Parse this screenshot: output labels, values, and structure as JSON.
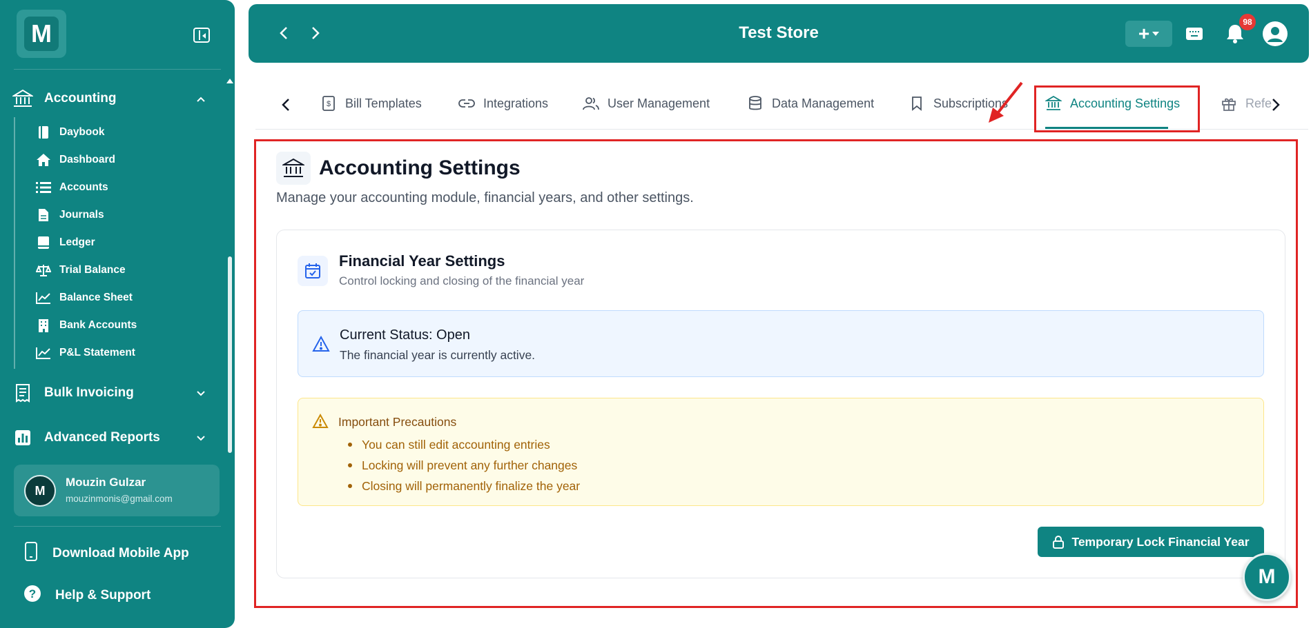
{
  "header": {
    "title": "Test Store",
    "notification_count": "98",
    "brand_color": "#0f8482"
  },
  "sidebar": {
    "logo_letter": "M",
    "accounting_label": "Accounting",
    "items": [
      {
        "label": "Daybook",
        "icon": "book-icon"
      },
      {
        "label": "Dashboard",
        "icon": "home-icon"
      },
      {
        "label": "Accounts",
        "icon": "list-icon"
      },
      {
        "label": "Journals",
        "icon": "file-icon"
      },
      {
        "label": "Ledger",
        "icon": "ledger-icon"
      },
      {
        "label": "Trial Balance",
        "icon": "scale-icon"
      },
      {
        "label": "Balance Sheet",
        "icon": "chart-line-icon"
      },
      {
        "label": "Bank Accounts",
        "icon": "building-icon"
      },
      {
        "label": "P&L Statement",
        "icon": "chart-line-icon"
      }
    ],
    "bulk_invoicing_label": "Bulk Invoicing",
    "advanced_reports_label": "Advanced Reports",
    "user": {
      "initial": "M",
      "name": "Mouzin Gulzar",
      "email": "mouzinmonis@gmail.com"
    },
    "download_app_label": "Download Mobile App",
    "help_label": "Help & Support"
  },
  "tabs": [
    {
      "label": "Bill Templates",
      "icon": "receipt-icon"
    },
    {
      "label": "Integrations",
      "icon": "link-icon"
    },
    {
      "label": "User Management",
      "icon": "users-icon"
    },
    {
      "label": "Data Management",
      "icon": "database-icon"
    },
    {
      "label": "Subscriptions",
      "icon": "bookmark-icon"
    },
    {
      "label": "Accounting Settings",
      "icon": "bank-icon",
      "active": true
    },
    {
      "label": "Refe",
      "icon": "gift-icon"
    }
  ],
  "page": {
    "title": "Accounting Settings",
    "subtitle": "Manage your accounting module, financial years, and other settings."
  },
  "card": {
    "title": "Financial Year Settings",
    "subtitle": "Control locking and closing of the financial year",
    "status_title": "Current Status: Open",
    "status_desc": "The financial year is currently active.",
    "precautions_title": "Important Precautions",
    "precautions": [
      "You can still edit accounting entries",
      "Locking will prevent any further changes",
      "Closing will permanently finalize the year"
    ],
    "lock_button": "Temporary Lock Financial Year"
  },
  "assistant": {
    "letter": "M"
  }
}
